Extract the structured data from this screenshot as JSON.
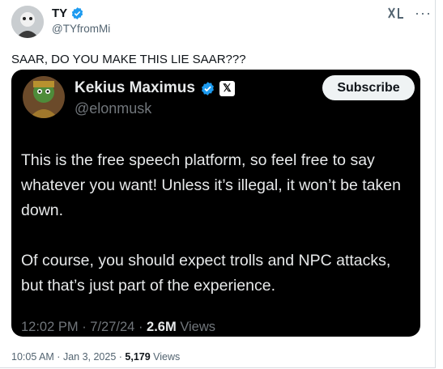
{
  "tweet": {
    "author_name": "TY",
    "author_handle": "@TYfromMi",
    "text": "SAAR, DO YOU MAKE THIS LIE SAAR???",
    "time": "10:05 AM",
    "date": "Jan 3, 2025",
    "views_count": "5,179",
    "views_label": "Views"
  },
  "quoted": {
    "author_name": "Kekius Maximus",
    "author_handle": "@elonmusk",
    "subscribe_label": "Subscribe",
    "x_badge": "𝕏",
    "paragraph1": "This is the free speech platform, so feel free to say whatever you want! Unless it’s illegal, it won’t be taken down.",
    "paragraph2": "Of course, you should expect trolls and NPC attacks, but that’s just part of the experience.",
    "time": "12:02 PM",
    "date": "7/27/24",
    "views_count": "2.6M",
    "views_label": "Views"
  },
  "icons": {
    "verified": "verified-badge-icon",
    "grok": "grok-icon",
    "more": "more-icon"
  },
  "colors": {
    "verified_blue": "#1d9bf0",
    "card_bg": "#000000",
    "muted": "#536471"
  }
}
